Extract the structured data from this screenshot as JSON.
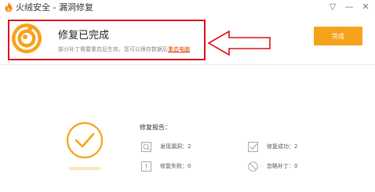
{
  "window": {
    "title": "火绒安全 - 漏洞修复",
    "controls": {
      "menu_glyph": "▽",
      "minimize_glyph": "—",
      "close_glyph": "✕"
    }
  },
  "header": {
    "status_title": "修复已完成",
    "status_subtitle": "部分补丁需要重启后生效，您可以保存数据后",
    "restart_link": "重启电脑",
    "done_button": "完成"
  },
  "report": {
    "title": "修复报告：",
    "items": {
      "found": "发现漏洞：2",
      "success": "修复成功：2",
      "failed": "修复失败：0",
      "ignored": "忽略补丁：0"
    }
  },
  "colors": {
    "accent_orange": "#f7a21b",
    "annotation_red": "#d9101a",
    "link_red": "#e23f00"
  },
  "icons": {
    "app": "huorong-logo-icon",
    "status": "repair-complete-icon",
    "result": "check-circle-icon",
    "found": "search-document-icon",
    "success": "checked-box-icon",
    "failed": "warning-box-icon",
    "ignored": "ignore-icon"
  }
}
